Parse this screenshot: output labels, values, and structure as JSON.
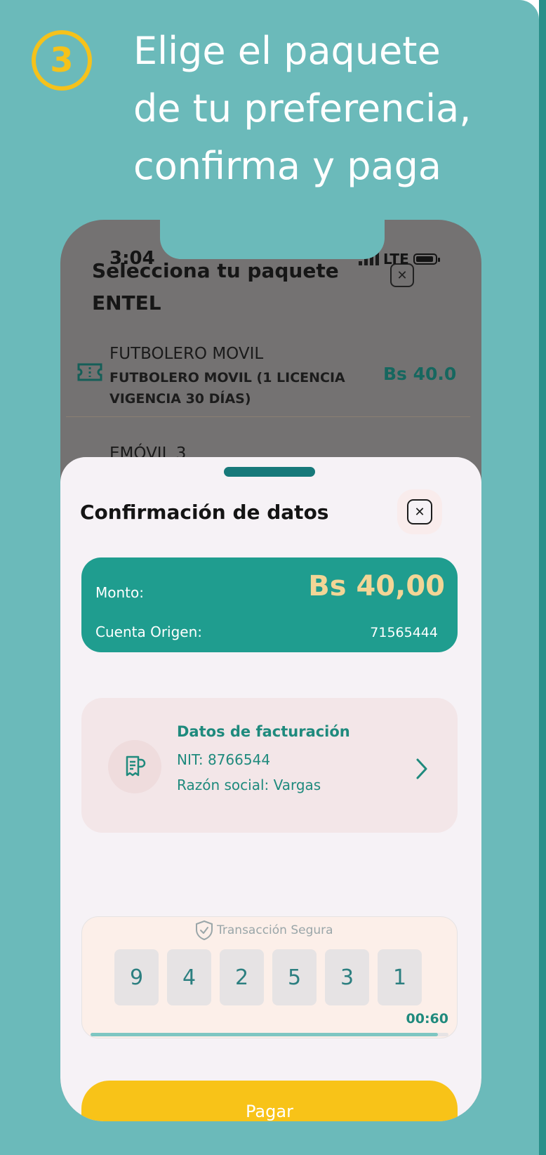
{
  "step": {
    "number": "3"
  },
  "headline": {
    "line1": "Elige el paquete",
    "line2": "de tu preferencia,",
    "line3": "confirma y paga"
  },
  "status_bar": {
    "time": "3:04",
    "network": "LTE"
  },
  "package_screen": {
    "title": "Selecciona tu paquete ENTEL",
    "close_label": "✕",
    "packages": [
      {
        "name": "FUTBOLERO MOVIL",
        "description": "FUTBOLERO MOVIL (1 LICENCIA VIGENCIA 30 DÍAS)",
        "price": "Bs 40.0"
      },
      {
        "name": "EMÓVIL 3"
      }
    ]
  },
  "confirmation": {
    "title": "Confirmación de datos",
    "close_label": "✕",
    "amount_label": "Monto:",
    "amount_value": "Bs 40,00",
    "origin_label": "Cuenta Origen:",
    "origin_value": "71565444",
    "billing": {
      "title": "Datos de facturación",
      "nit": "NIT: 8766544",
      "razon_social": "Razón social: Vargas"
    },
    "token": {
      "secure_label": "Transacción Segura",
      "digits": [
        "9",
        "4",
        "2",
        "5",
        "3",
        "1"
      ],
      "timer": "00:60",
      "progress": 0.97
    },
    "pay_label": "Pagar"
  },
  "colors": {
    "background": "#6bbaba",
    "accent_yellow": "#f5c21b",
    "teal_card": "#1f9d8f",
    "teal_text": "#1f8a7d",
    "amount_gold": "#f2d596"
  }
}
